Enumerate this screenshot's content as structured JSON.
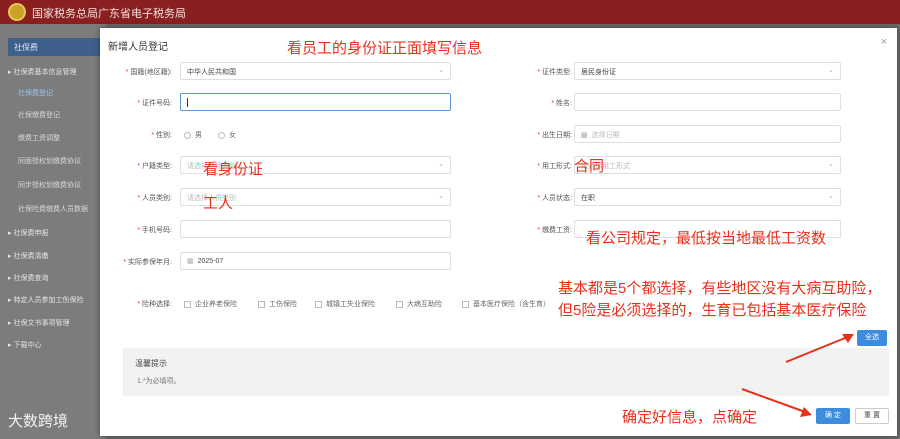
{
  "header": {
    "site_title": "国家税务总局广东省电子税务局"
  },
  "sidebar": {
    "header": "社保费",
    "items": [
      {
        "label": "▸ 社保费基本信息管理",
        "level": 0,
        "active": false
      },
      {
        "label": "社保费登记",
        "level": 1,
        "active": true
      },
      {
        "label": "社保缴费登记",
        "level": 1,
        "active": false
      },
      {
        "label": "缴费工资调整",
        "level": 1,
        "active": false
      },
      {
        "label": "同面授权划缴费协议",
        "level": 1,
        "active": false
      },
      {
        "label": "同步授权划缴费协议",
        "level": 1,
        "active": false
      },
      {
        "label": "社保险费缴费人员数据",
        "level": 1,
        "active": false
      },
      {
        "label": "▸ 社保费申报",
        "level": 0,
        "active": false
      },
      {
        "label": "▸ 社保费清缴",
        "level": 0,
        "active": false
      },
      {
        "label": "▸ 社保费查询",
        "level": 0,
        "active": false
      },
      {
        "label": "▸ 特定人员参加工伤保险",
        "level": 0,
        "active": false
      },
      {
        "label": "▸ 社保文书事项管理",
        "level": 0,
        "active": false
      },
      {
        "label": "▸ 下载中心",
        "level": 0,
        "active": false
      }
    ]
  },
  "modal": {
    "title": "新增人员登记",
    "close": "×",
    "fields": {
      "nationality": {
        "label": "国籍(地区籍):",
        "value": "中华人民共和国"
      },
      "cert_type": {
        "label": "证件类型:",
        "value": "居民身份证"
      },
      "cert_no": {
        "label": "证件号码:",
        "value": ""
      },
      "name": {
        "label": "姓名:",
        "value": ""
      },
      "gender": {
        "label": "性别:",
        "options": [
          "男",
          "女"
        ]
      },
      "birth_date": {
        "label": "出生日期:",
        "placeholder": "选择日期"
      },
      "hukou": {
        "label": "户籍类型:",
        "placeholder": "请选择户籍类型"
      },
      "employment": {
        "label": "用工形式:",
        "placeholder": "请选择用工形式"
      },
      "person_category": {
        "label": "人员类别:",
        "placeholder": "请选择人员类别"
      },
      "person_status": {
        "label": "人员状态:",
        "value": "在职"
      },
      "phone": {
        "label": "手机号码:",
        "value": ""
      },
      "wage": {
        "label": "缴费工资:",
        "value": ""
      },
      "insured_month": {
        "label": "实际参保年月:",
        "value": "2025-07"
      },
      "insurance": {
        "label": "险种选择:",
        "options": [
          "企业养老保险",
          "工伤保险",
          "城镇工失业保险",
          "大病互助险",
          "基本医疗保险（含生育）"
        ]
      }
    },
    "notice": {
      "title": "温馨提示",
      "body": "1.*为必填项。"
    },
    "buttons": {
      "select_all": "全选",
      "confirm": "确 定",
      "reset": "重 置"
    }
  },
  "annotations": {
    "top": "看员工的身份证正面填写信息",
    "id_card": "看身份证",
    "worker": "工人",
    "contract": "合同",
    "wage": "看公司规定，最低按当地最低工资数",
    "insurance": "基本都是5个都选择，有些地区没有大病互助险，但5险是必须选择的，生育已包括基本医疗保险",
    "confirm": "确定好信息，点确定"
  },
  "watermark": "大数跨境"
}
